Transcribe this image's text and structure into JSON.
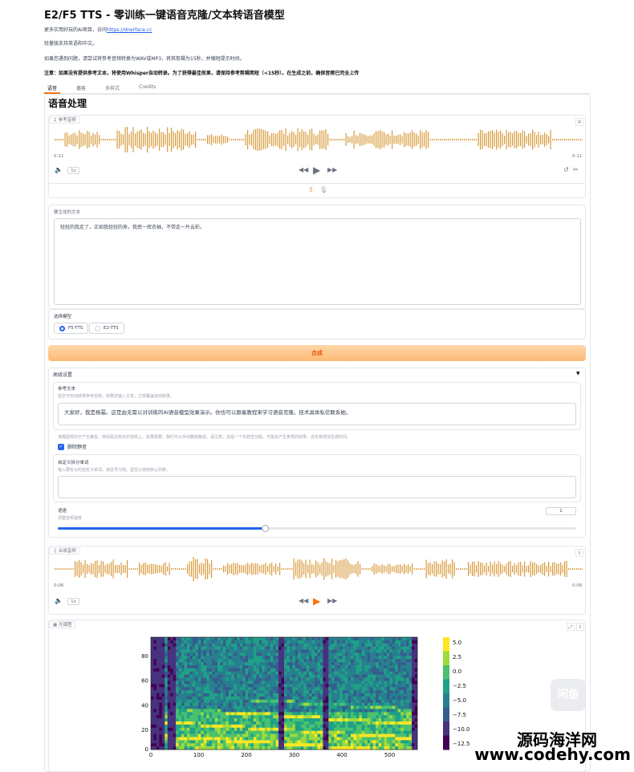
{
  "header": {
    "title": "E2/F5 TTS - 零训练一键语音克隆/文本转语音模型",
    "line1_prefix": "更多实用好玩的AI项目，访问",
    "line1_link": "https://dnerface.cc",
    "line2": "轻量版支持英语和中文。",
    "line3": "如果您遇到问题，请尝试将参考音频转换为WAV或MP3，将其剪辑为15秒，并缩短提示时间。",
    "note": "注意：如果没有提供参考文本，将使用Whisper自动转录。为了获得最佳效果，请保持参考剪辑简短（<15秒）。在生成之前，确保音频已完全上传"
  },
  "tabs": [
    {
      "label": "语音",
      "active": true
    },
    {
      "label": "播客",
      "active": false
    },
    {
      "label": "多样式",
      "active": false
    },
    {
      "label": "Credits",
      "active": false
    }
  ],
  "section_title": "语音处理",
  "ref_audio": {
    "label": "参考音频",
    "time_start": "0:11",
    "time_end": "0:11",
    "speed": "1x",
    "color": "#d89b3d"
  },
  "gen_text": {
    "label": "要生成的文本",
    "value": "轻轻的我走了，正如我轻轻的来，我挥一挥衣袖，不带走一片云彩。"
  },
  "model": {
    "label": "选择模型",
    "options": [
      {
        "label": "F5-TTS",
        "selected": true
      },
      {
        "label": "E2-TTS",
        "selected": false
      }
    ]
  },
  "synthesize_label": "合成",
  "advanced": {
    "label": "高级设置",
    "caret": "▼",
    "ref_text_label": "参考文本",
    "ref_text_sub": "留空可自动转录参考音频。如果您输入文本，它将覆盖自动转录。",
    "ref_text_value": "大家好，我是杨幂。这是由无需以对训练的AI语音模型效果演示。你也可以跟着教程来学习语音克隆。技术具体私信联系她。",
    "remove_silence_note": "该模型倾向于产生静音，特别是在较长的音频上。如果需要，我们可以手动删除静音。请注意，这是一个实验性功能，可能会产生奇怪的结果。这也将增加生成时间。",
    "remove_silence_label": "删除静音",
    "custom_split_label": "自定义拆分单词",
    "custom_split_sub": "输入要拆分的自定义单词，用逗号分隔。留空以使用默认列表。",
    "speed_label": "语速",
    "speed_sub": "调整音频速度",
    "speed_value": "1",
    "speed_fraction": 0.4
  },
  "out_audio": {
    "label": "合成音频",
    "time_start": "0:06",
    "time_end": "0:06",
    "speed": "1x",
    "color": "#d89b3d",
    "accent": "#f97316"
  },
  "spectrogram": {
    "label": "光谱图",
    "yticks": [
      "80",
      "60",
      "40",
      "20",
      "0"
    ],
    "xticks": [
      "0",
      "100",
      "200",
      "300",
      "400",
      "500"
    ],
    "cbar_ticks": [
      "5.0",
      "2.5",
      "0.0",
      "−2.5",
      "−5.0",
      "−7.5",
      "−10.0",
      "−12.5"
    ]
  },
  "icons": {
    "volume": "volume-icon",
    "rewind": "rewind-icon",
    "play": "play-icon",
    "forward": "forward-icon",
    "undo": "undo-icon",
    "cut": "scissors-icon",
    "upload": "upload-icon",
    "mic": "microphone-icon",
    "close": "close-icon",
    "download": "download-icon"
  },
  "watermark": {
    "brand": "源码海洋网",
    "url": "www.codehy.com",
    "logo": "闲鱼"
  }
}
